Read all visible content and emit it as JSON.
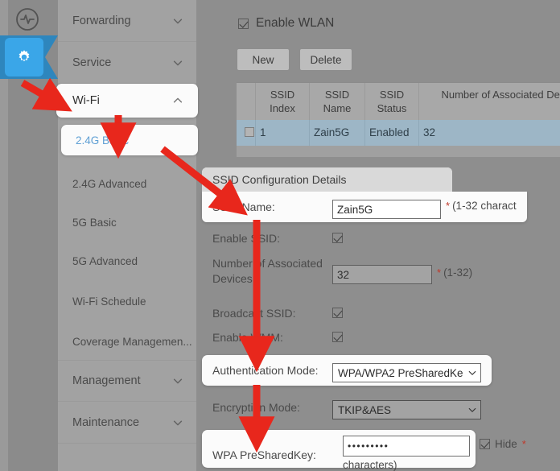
{
  "rail": {
    "top_icon": "activity-monitor-icon",
    "active_icon": "gear-icon",
    "active_color": "#3aa6e8",
    "tab_color": "#2e86bd"
  },
  "sidebar": {
    "groups": [
      {
        "label": "Forwarding",
        "chevron": "chevron-down-icon"
      },
      {
        "label": "Service",
        "chevron": "chevron-down-icon"
      },
      {
        "label": "Wi-Fi",
        "chevron": "chevron-up-icon"
      }
    ],
    "subitems": [
      {
        "label": "2.4G Basic",
        "selected": true
      },
      {
        "label": "2.4G Advanced",
        "selected": false
      },
      {
        "label": "5G Basic",
        "selected": false
      },
      {
        "label": "5G Advanced",
        "selected": false
      },
      {
        "label": "Wi-Fi Schedule",
        "selected": false
      },
      {
        "label": "Coverage Managemen...",
        "selected": false
      }
    ],
    "groups_bottom": [
      {
        "label": "Management",
        "chevron": "chevron-down-icon"
      },
      {
        "label": "Maintenance",
        "chevron": "chevron-down-icon"
      }
    ]
  },
  "content": {
    "enable_wlan_label": "Enable WLAN",
    "enable_wlan_checked": true,
    "buttons": {
      "new": "New",
      "delete": "Delete"
    },
    "table": {
      "headers": [
        "",
        "SSID Index",
        "SSID Name",
        "SSID Status",
        "Number of Associated Devices"
      ],
      "rows": [
        {
          "checked": false,
          "index": "1",
          "name": "Zain5G",
          "status": "Enabled",
          "devices": "32"
        }
      ]
    },
    "config": {
      "title": "SSID Configuration Details",
      "ssid_name_label": "SSID Name:",
      "ssid_name_value": "Zain5G",
      "ssid_name_hint": "(1-32 charact",
      "enable_ssid_label": "Enable SSID:",
      "enable_ssid_checked": true,
      "assoc_label_1": "Number of Associated",
      "assoc_label_2": "Devices:",
      "assoc_value": "32",
      "assoc_hint": "(1-32)",
      "broadcast_label": "Broadcast SSID:",
      "broadcast_checked": true,
      "wmm_label": "Enable WMM:",
      "wmm_checked": true,
      "auth_label": "Authentication Mode:",
      "auth_value": "WPA/WPA2 PreSharedKe",
      "encryption_label": "Encryption Mode:",
      "encryption_value": "TKIP&AES",
      "psk_label": "WPA PreSharedKey:",
      "psk_value": "•••••••••",
      "psk_hint": "characters)",
      "hide_label": "Hide",
      "hide_checked": true
    }
  },
  "annotations": {
    "color": "#e8271c",
    "arrows": [
      {
        "name": "arrow-to-wifi-menu"
      },
      {
        "name": "arrow-to-24g-basic"
      },
      {
        "name": "arrow-to-ssid-name"
      },
      {
        "name": "arrow-to-authentication-mode"
      },
      {
        "name": "arrow-to-wpa-presharedkey"
      }
    ]
  }
}
